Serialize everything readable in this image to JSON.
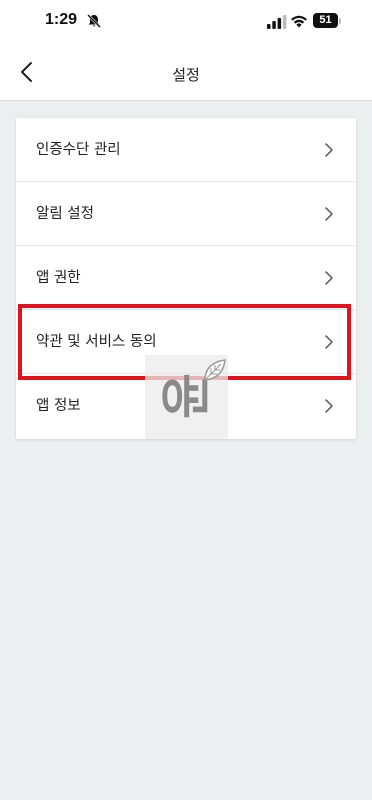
{
  "status_bar": {
    "time": "1:29",
    "battery": "51"
  },
  "header": {
    "title": "설정"
  },
  "menu": {
    "items": [
      {
        "label": "인증수단 관리"
      },
      {
        "label": "알림 설정"
      },
      {
        "label": "앱 권한"
      },
      {
        "label": "약관 및 서비스 동의"
      },
      {
        "label": "앱 정보"
      }
    ]
  },
  "watermark": {
    "text": "윤"
  },
  "colors": {
    "background": "#eceff0",
    "highlight": "#e0121b"
  },
  "icons": [
    "bell-off-icon",
    "signal-icon",
    "wifi-icon",
    "battery-icon",
    "back-arrow-icon",
    "chevron-right-icon",
    "leaf-icon"
  ]
}
